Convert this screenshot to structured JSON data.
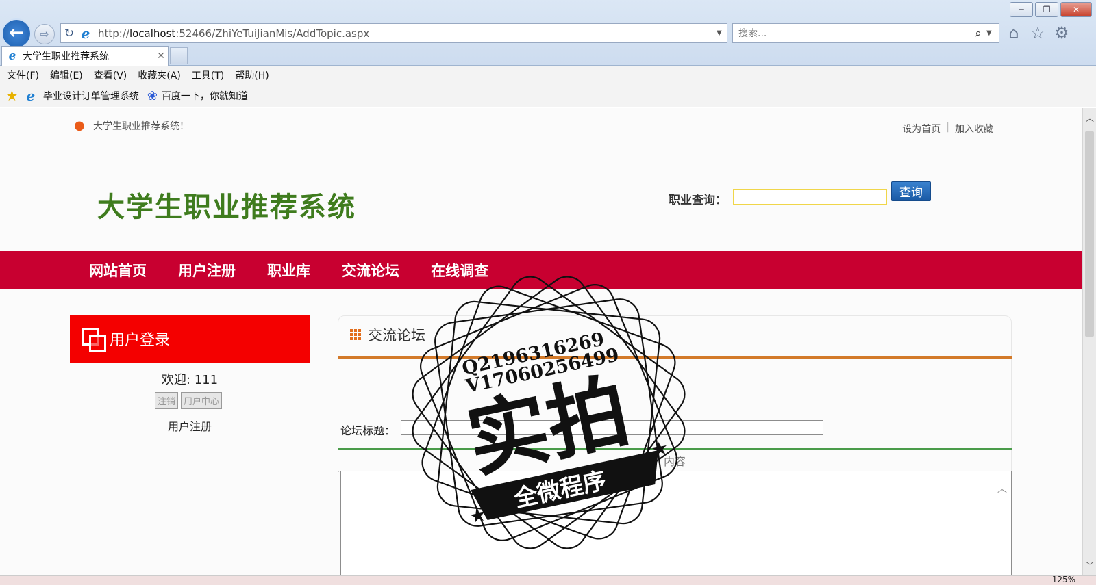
{
  "window": {
    "controls": {
      "minimize": "─",
      "restore": "❐",
      "close": "✕"
    }
  },
  "browser": {
    "url_prefix": "http://",
    "url_host": "localhost",
    "url_rest": ":52466/ZhiYeTuiJianMis/AddTopic.aspx",
    "search_placeholder": "搜索...",
    "tab_title": "大学生职业推荐系统",
    "menu": [
      "文件(F)",
      "编辑(E)",
      "查看(V)",
      "收藏夹(A)",
      "工具(T)",
      "帮助(H)"
    ],
    "favorites": [
      "毕业设计订单管理系统",
      "百度一下，你就知道"
    ],
    "zoom": "125%",
    "icons": {
      "back": "←",
      "forward": "⇨",
      "refresh": "↻",
      "ie": "e",
      "search": "⌕",
      "home": "⌂",
      "star": "☆",
      "gear": "⚙",
      "close_tab": "✕",
      "fav_star": "★",
      "paw": "❀",
      "dropdown": "▼",
      "scroll_up": "︿",
      "scroll_down": "﹀"
    }
  },
  "page": {
    "welcome_top": "大学生职业推荐系统！",
    "toplinks": {
      "home": "设为首页",
      "separator": "|",
      "favorite": "加入收藏"
    },
    "site_title": "大学生职业推荐系统",
    "job_search_label": "职业查询：",
    "job_search_button": "查询",
    "nav": [
      "网站首页",
      "用户注册",
      "职业库",
      "交流论坛",
      "在线调查"
    ],
    "login": {
      "title": "用户登录",
      "welcome": "欢迎: 111",
      "logout": "注销",
      "user_center": "用户中心",
      "register": "用户注册"
    },
    "forum": {
      "title": "交流论坛",
      "topic_label": "论坛标题：",
      "content_label": "内容"
    }
  },
  "watermark": {
    "line1": "Q2196316269",
    "line2": "V17060256499",
    "main": "实拍",
    "banner": "全微程序"
  },
  "colors": {
    "nav_red": "#c80030",
    "login_red": "#f40000",
    "title_green": "#3f7c1e",
    "forum_orange": "#d37a2a"
  }
}
